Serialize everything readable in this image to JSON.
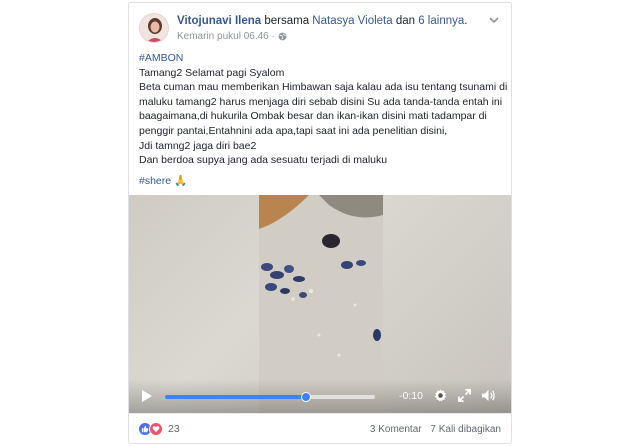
{
  "post": {
    "author": "Vitojunavi Ilena",
    "with_text": " bersama ",
    "tagged": "Natasya Violeta",
    "and_text": " dan ",
    "others": "6 lainnya",
    "period": ".",
    "timestamp": "Kemarin pukul 06.46 ·",
    "privacy_icon": "globe-icon",
    "menu_icon": "chevron-down-icon",
    "hashtag_top": "#AMBON",
    "lines": [
      "Tamang2 Selamat pagi Syalom",
      "Beta cuman mau memberikan Himbawan saja kalau ada isu tentang tsunami di",
      "maluku tamang2 harus menjaga diri sebab disini Su ada tanda-tanda entah ini",
      "baagaimana,di hukurila Ombak besar dan ikan-ikan disini mati tadampar di",
      "penggir pantai,Entahnini ada apa,tapi saat ini ada penelitian disini,",
      "Jdi tamng2 jaga diri bae2",
      "Dan berdoa supya jang ada sesuatu terjadi di maluku"
    ],
    "hashtag_bottom": "#shere",
    "emoji": "🙏"
  },
  "video": {
    "time_remaining": "-0:10",
    "progress": 0.67,
    "icons": [
      "play-icon",
      "settings-icon",
      "fullscreen-icon",
      "volume-icon"
    ],
    "accent_color": "#4080ff"
  },
  "footer": {
    "reaction_count": "23",
    "comments": "3 Komentar",
    "shares": "7 Kali dibagikan"
  }
}
